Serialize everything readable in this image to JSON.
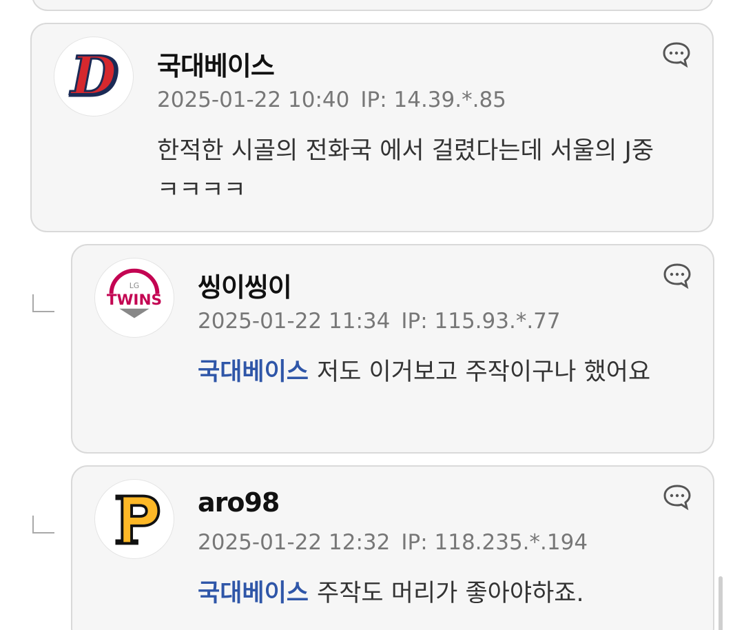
{
  "comments": [
    {
      "nickname": "국대베이스",
      "avatar_icon": "doosan-bears-d-logo-icon",
      "datetime": "2025-01-22 10:40",
      "ip": "IP: 14.39.*.85",
      "mention": "",
      "text": "한적한 시골의 전화국 에서 걸렸다는데 서울의 J중 ㅋㅋㅋㅋ"
    },
    {
      "nickname": "씽이씽이",
      "avatar_icon": "lg-twins-logo-icon",
      "avatar_text": "TWINS",
      "avatar_small_text": "LG",
      "datetime": "2025-01-22 11:34",
      "ip": "IP: 115.93.*.77",
      "mention": "국대베이스",
      "text": "저도 이거보고 주작이구나 했어요"
    },
    {
      "nickname": "aro98",
      "avatar_icon": "pittsburgh-p-logo-icon",
      "datetime": "2025-01-22 12:32",
      "ip": "IP: 118.235.*.194",
      "mention": "국대베이스",
      "text": "주작도 머리가 좋아야하죠."
    }
  ],
  "icons": {
    "reply": "reply-bubble-icon",
    "indent": "reply-indent-icon"
  },
  "colors": {
    "mention": "#2f56a8",
    "card_bg": "#f6f6f6",
    "card_border": "#d9d9d9",
    "meta": "#777777"
  }
}
